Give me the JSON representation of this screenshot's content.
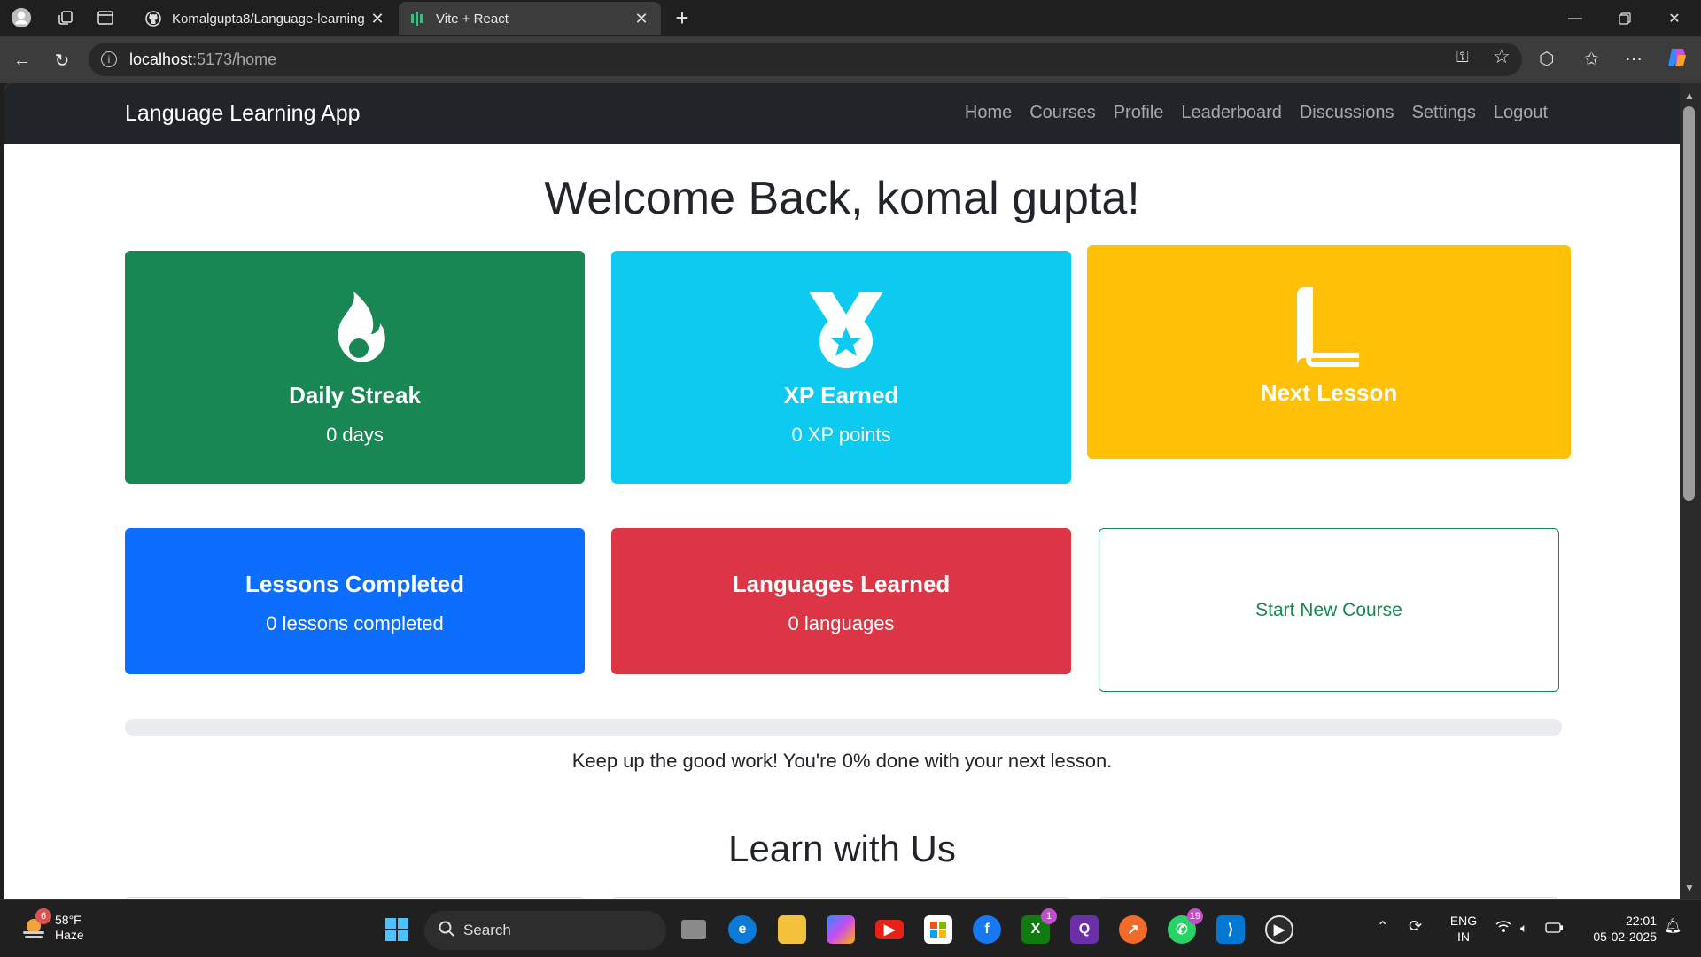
{
  "browser": {
    "tabs": [
      {
        "title": "Komalgupta8/Language-learning",
        "active": false
      },
      {
        "title": "Vite + React",
        "active": true
      }
    ],
    "url_host": "localhost",
    "url_path": ":5173/home"
  },
  "app": {
    "brand": "Language Learning App",
    "nav": [
      "Home",
      "Courses",
      "Profile",
      "Leaderboard",
      "Discussions",
      "Settings",
      "Logout"
    ],
    "welcome": "Welcome Back, komal gupta!",
    "cards": {
      "streak": {
        "title": "Daily Streak",
        "value": "0 days",
        "color": "#198754",
        "icon": "fire-icon"
      },
      "xp": {
        "title": "XP Earned",
        "value": "0 XP points",
        "color": "#0dcaf0",
        "icon": "medal-icon"
      },
      "next": {
        "title": "Next Lesson",
        "color": "#ffc107",
        "icon": "book-icon"
      },
      "lessons": {
        "title": "Lessons Completed",
        "value": "0 lessons completed",
        "color": "#0d6efd"
      },
      "languages": {
        "title": "Languages Learned",
        "value": "0 languages",
        "color": "#dc3545"
      },
      "new_course": {
        "label": "Start New Course",
        "color": "#198754"
      }
    },
    "progress_percent": 0,
    "progress_text": "Keep up the good work! You're 0% done with your next lesson.",
    "learn_heading": "Learn with Us"
  },
  "taskbar": {
    "weather_temp": "58°F",
    "weather_desc": "Haze",
    "weather_badge": "6",
    "search_label": "Search",
    "xbox_badge": "1",
    "whatsapp_badge": "19",
    "lang_top": "ENG",
    "lang_bottom": "IN",
    "time": "22:01",
    "date": "05-02-2025"
  }
}
